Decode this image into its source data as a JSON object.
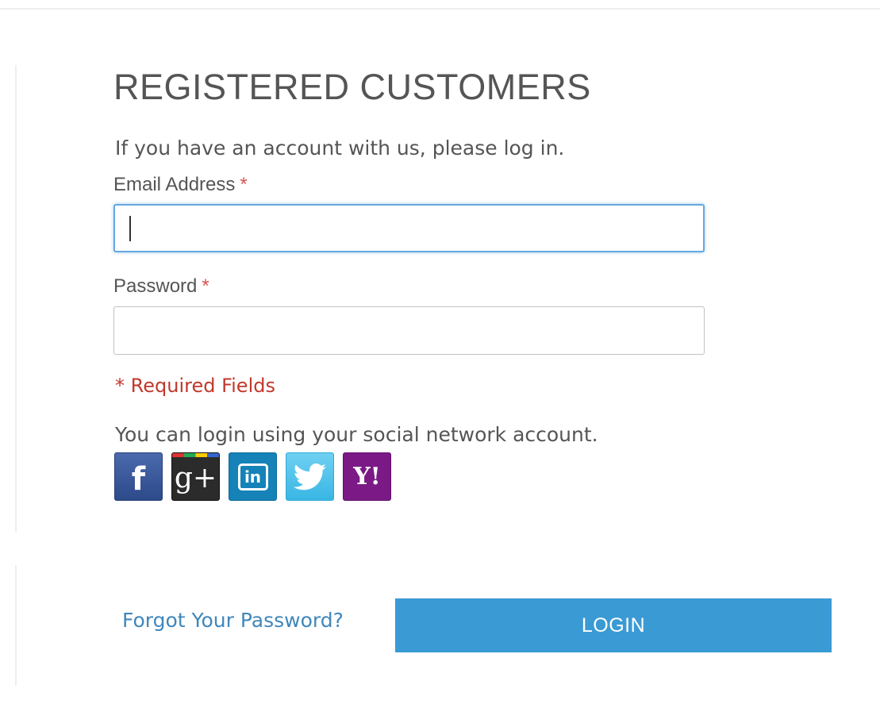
{
  "block_title": "REGISTERED CUSTOMERS",
  "intro_text": "If you have an account with us, please log in.",
  "email_field": {
    "label": "Email Address",
    "required_mark": "*",
    "value": ""
  },
  "password_field": {
    "label": "Password",
    "required_mark": "*",
    "value": ""
  },
  "required_note": "* Required Fields",
  "social": {
    "text": "You can login using your social network account.",
    "providers": [
      {
        "name": "facebook",
        "glyph": "f",
        "icon": "facebook-icon",
        "color": "#3b5998"
      },
      {
        "name": "google-plus",
        "glyph": "g+",
        "icon": "google-plus-icon",
        "color": "#2b2b2b"
      },
      {
        "name": "linkedin",
        "glyph": "in",
        "icon": "linkedin-icon",
        "color": "#1582b8"
      },
      {
        "name": "twitter",
        "glyph": "",
        "icon": "twitter-bird-icon",
        "color": "#55c5ef"
      },
      {
        "name": "yahoo",
        "glyph": "Y!",
        "icon": "yahoo-icon",
        "color": "#7b1a86"
      }
    ]
  },
  "forgot_link": "Forgot Your Password?",
  "login_button": "LOGIN",
  "colors": {
    "accent": "#3a9ad4",
    "link": "#3f87bc",
    "required": "#c0392b",
    "focus_border": "#66a8e0"
  }
}
